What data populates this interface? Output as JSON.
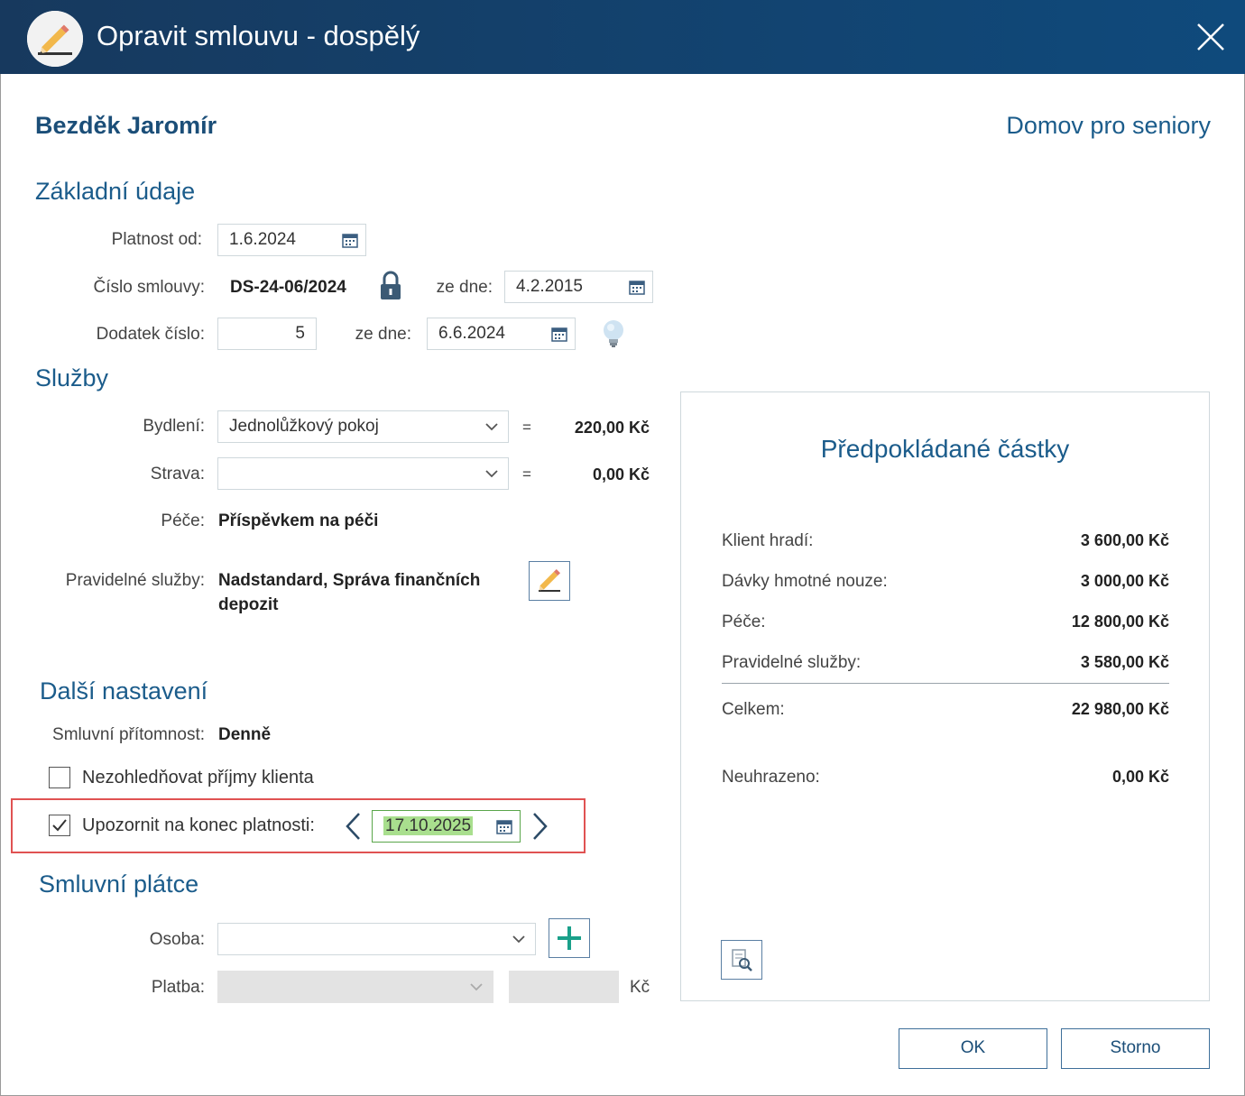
{
  "window": {
    "title": "Opravit smlouvu - dospělý",
    "close_icon": "close-icon"
  },
  "header": {
    "client_name": "Bezděk Jaromír",
    "facility": "Domov pro seniory"
  },
  "basic": {
    "section_title": "Základní údaje",
    "valid_from_label": "Platnost od:",
    "valid_from_value": "1.6.2024",
    "contract_no_label": "Číslo smlouvy:",
    "contract_no_value": "DS-24-06/2024",
    "contract_date_label": "ze dne:",
    "contract_date_value": "4.2.2015",
    "amendment_label": "Dodatek číslo:",
    "amendment_value": "5",
    "amendment_date_label": "ze dne:",
    "amendment_date_value": "6.6.2024"
  },
  "services": {
    "section_title": "Služby",
    "housing_label": "Bydlení:",
    "housing_value": "Jednolůžkový pokoj",
    "housing_eq": "=",
    "housing_amount": "220,00 Kč",
    "food_label": "Strava:",
    "food_value": "",
    "food_eq": "=",
    "food_amount": "0,00 Kč",
    "care_label": "Péče:",
    "care_value": "Příspěvkem na péči",
    "regular_label": "Pravidelné služby:",
    "regular_value_line1": "Nadstandard, Správa finančních",
    "regular_value_line2": "depozit"
  },
  "other": {
    "section_title": "Další nastavení",
    "presence_label": "Smluvní přítomnost:",
    "presence_value": "Denně",
    "ignore_income_label": "Nezohledňovat příjmy klienta",
    "ignore_income_checked": false,
    "notify_end_label": "Upozornit na konec platnosti:",
    "notify_end_checked": true,
    "notify_end_date": "17.10.2025"
  },
  "payer": {
    "section_title": "Smluvní plátce",
    "person_label": "Osoba:",
    "person_value": "",
    "payment_label": "Platba:",
    "payment_value": "",
    "payment_amount": "",
    "currency": "Kč"
  },
  "estimates": {
    "title": "Předpokládané částky",
    "rows": [
      {
        "label": "Klient hradí:",
        "amount": "3 600,00 Kč"
      },
      {
        "label": "Dávky hmotné nouze:",
        "amount": "3 000,00 Kč"
      },
      {
        "label": "Péče:",
        "amount": "12 800,00 Kč"
      },
      {
        "label": "Pravidelné služby:",
        "amount": "3 580,00 Kč"
      }
    ],
    "total_label": "Celkem:",
    "total_amount": "22 980,00 Kč",
    "unpaid_label": "Neuhrazeno:",
    "unpaid_amount": "0,00 Kč"
  },
  "buttons": {
    "ok": "OK",
    "cancel": "Storno"
  },
  "colors": {
    "titlebar": "#17395e",
    "accent": "#1b5c8b",
    "highlight_border": "#e05252",
    "date_highlight": "#a9df8e",
    "add_icon": "#1aa08a"
  }
}
